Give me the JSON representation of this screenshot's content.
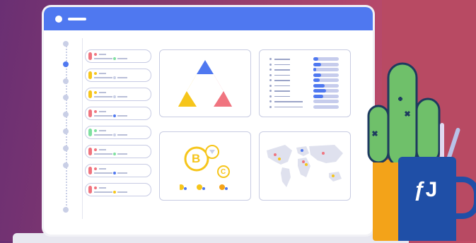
{
  "mug": {
    "logo_text": "ƒJ"
  },
  "dashboard": {
    "coin_labels": [
      "B",
      "C"
    ]
  },
  "colors": {
    "accent": "#4f78f0",
    "red": "#f0747f",
    "yellow": "#f6c51a",
    "green": "#7fe0a0",
    "blue": "#4f78f0",
    "orange": "#f3a319",
    "cactus": "#6fc06a",
    "mug": "#1f4fa7"
  },
  "side_pills": [
    {
      "bar": "#f0747f",
      "dot": "#f0747f",
      "dot2": "#7fe0a0"
    },
    {
      "bar": "#f6c51a",
      "dot": "#f6c51a",
      "dot2": "#c9cfe6"
    },
    {
      "bar": "#f6c51a",
      "dot": "#f6c51a",
      "dot2": "#c9cfe6"
    },
    {
      "bar": "#f0747f",
      "dot": "#f0747f",
      "dot2": "#4f78f0"
    },
    {
      "bar": "#7fe0a0",
      "dot": "#7fe0a0",
      "dot2": "#c9cfe6"
    },
    {
      "bar": "#f0747f",
      "dot": "#f0747f",
      "dot2": "#7fe0a0"
    },
    {
      "bar": "#f0747f",
      "dot": "#f0747f",
      "dot2": "#4f78f0"
    },
    {
      "bar": "#f0747f",
      "dot": "#f0747f",
      "dot2": "#f6c51a"
    }
  ],
  "bar_rows": [
    0.2,
    0.3,
    0.1,
    0.3,
    0.25,
    0.45,
    0.5,
    0.4,
    0,
    0
  ]
}
